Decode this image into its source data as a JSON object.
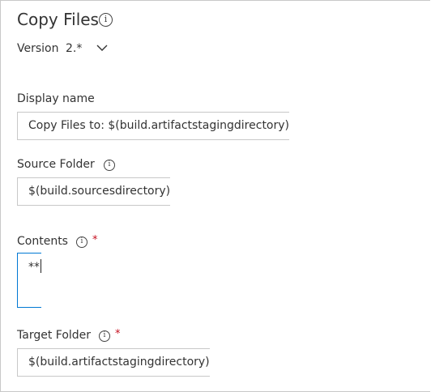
{
  "header": {
    "title": "Copy Files",
    "version_label": "Version",
    "version_value": "2.*"
  },
  "fields": {
    "display_name": {
      "label": "Display name",
      "value": "Copy Files to: $(build.artifactstagingdirectory)"
    },
    "source_folder": {
      "label": "Source Folder",
      "value": "$(build.sourcesdirectory)"
    },
    "contents": {
      "label": "Contents",
      "required": "*",
      "value": "**"
    },
    "target_folder": {
      "label": "Target Folder",
      "required": "*",
      "value": "$(build.artifactstagingdirectory)"
    }
  },
  "icons": {
    "info": "info-icon",
    "chevron": "chevron-down-icon"
  },
  "colors": {
    "focus_border": "#0078d4",
    "required_asterisk": "#c50f1f",
    "border": "#c8c8c8"
  }
}
